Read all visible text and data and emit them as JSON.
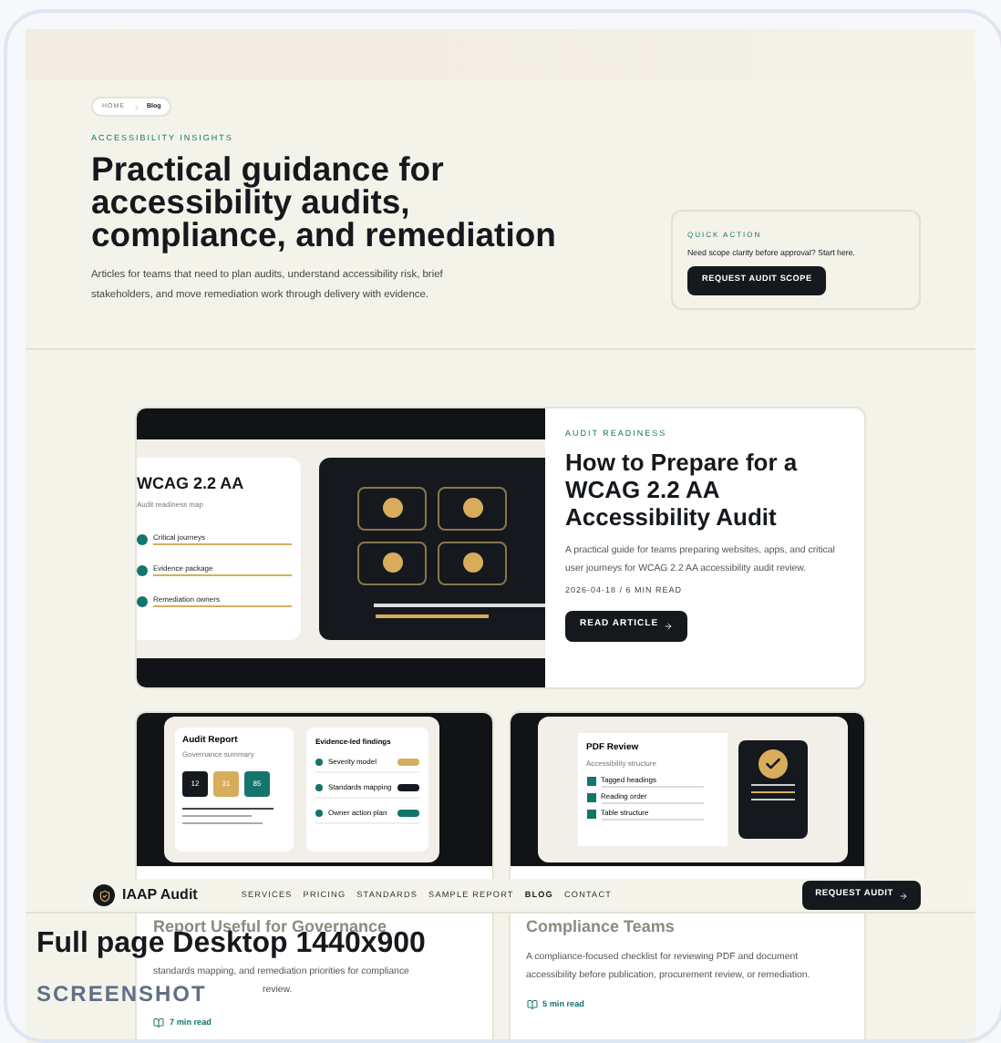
{
  "breadcrumb": [
    {
      "label": "HOME",
      "selected": false
    },
    {
      "label": "Blog",
      "selected": true
    }
  ],
  "hero": {
    "eyebrow": "ACCESSIBILITY INSIGHTS",
    "title": "Practical guidance for accessibility audits, compliance, and remediation",
    "intro": "Articles for teams that need to plan audits, understand accessibility risk, brief stakeholders, and move remediation work through delivery with evidence."
  },
  "quick_action": {
    "label": "QUICK ACTION",
    "text": "Need scope clarity before approval? Start here.",
    "button": "REQUEST AUDIT SCOPE"
  },
  "featured": {
    "illustration": {
      "title": "WCAG 2.2 AA",
      "subtitle": "Audit readiness map",
      "items": [
        "Critical journeys",
        "Evidence package",
        "Remediation owners"
      ]
    },
    "eyebrow": "AUDIT READINESS",
    "title": "How to Prepare for a WCAG 2.2 AA Accessibility Audit",
    "excerpt": "A practical guide for teams preparing websites, apps, and critical user journeys for WCAG 2.2 AA accessibility audit review.",
    "meta": "2026-04-18 / 6 MIN READ",
    "button": "READ ARTICLE"
  },
  "cards": [
    {
      "kind": "report",
      "illustration": {
        "title": "Audit Report",
        "subtitle": "Governance summary",
        "tiles": [
          {
            "value": "12",
            "color": "#15191d"
          },
          {
            "value": "31",
            "color": "#d7ad5c"
          },
          {
            "value": "85",
            "color": "#13756b"
          }
        ],
        "panel_title": "Evidence-led findings",
        "rows": [
          {
            "label": "Severity model",
            "color": "#d7ad5c"
          },
          {
            "label": "Standards mapping",
            "color": "#15191d"
          },
          {
            "label": "Owner action plan",
            "color": "#13756b"
          }
        ]
      },
      "title": "Report Useful for Governance",
      "excerpt": "standards mapping, and remediation priorities for compliance",
      "excerpt_end": "review.",
      "read_time": "7 min read"
    },
    {
      "kind": "pdf",
      "illustration": {
        "title": "PDF Review",
        "subtitle": "Accessibility structure",
        "items": [
          "Tagged headings",
          "Reading order",
          "Table structure"
        ]
      },
      "title": "Compliance Teams",
      "excerpt": "A compliance-focused checklist for reviewing PDF and document accessibility before publication, procurement review, or remediation.",
      "read_time": "5 min read"
    }
  ],
  "nav": {
    "brand": "IAAP Audit",
    "links": [
      {
        "label": "SERVICES",
        "selected": false
      },
      {
        "label": "PRICING",
        "selected": false
      },
      {
        "label": "STANDARDS",
        "selected": false
      },
      {
        "label": "SAMPLE REPORT",
        "selected": false
      },
      {
        "label": "BLOG",
        "selected": true
      },
      {
        "label": "CONTACT",
        "selected": false
      }
    ],
    "button": "REQUEST AUDIT"
  },
  "caption": {
    "title": "Full page Desktop 1440x900",
    "subtitle": "SCREENSHOT"
  }
}
